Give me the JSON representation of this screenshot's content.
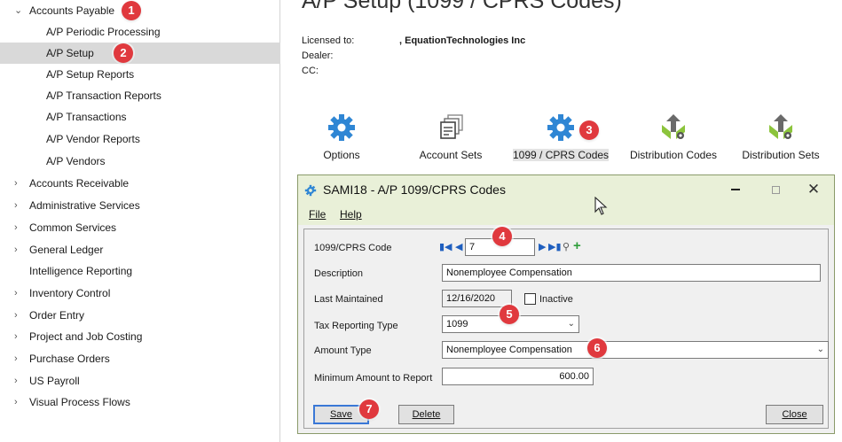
{
  "nav": {
    "items": [
      {
        "label": "Accounts Payable",
        "expanded": true,
        "badge": "1"
      },
      {
        "label": "A/P Periodic Processing"
      },
      {
        "label": "A/P Setup",
        "selected": true,
        "badge": "2"
      },
      {
        "label": "A/P Setup Reports"
      },
      {
        "label": "A/P Transaction Reports"
      },
      {
        "label": "A/P Transactions"
      },
      {
        "label": "A/P Vendor Reports"
      },
      {
        "label": "A/P Vendors"
      },
      {
        "label": "Accounts Receivable"
      },
      {
        "label": "Administrative Services"
      },
      {
        "label": "Common Services"
      },
      {
        "label": "General Ledger"
      },
      {
        "label": "Intelligence Reporting"
      },
      {
        "label": "Inventory Control"
      },
      {
        "label": "Order Entry"
      },
      {
        "label": "Project and Job Costing"
      },
      {
        "label": "Purchase Orders"
      },
      {
        "label": "US Payroll"
      },
      {
        "label": "Visual Process Flows"
      }
    ]
  },
  "main": {
    "title": "A/P Setup (1099 / CPRS Codes)",
    "licensed_label": "Licensed to:",
    "licensed_value": ", EquationTechnologies Inc",
    "dealer_label": "Dealer:",
    "cc_label": "CC:",
    "tiles": [
      {
        "label": "Options",
        "icon": "gear-icon"
      },
      {
        "label": "Account Sets",
        "icon": "account-sets-icon"
      },
      {
        "label": "1099 / CPRS Codes",
        "icon": "gear-icon",
        "badge": "3"
      },
      {
        "label": "Distribution Codes",
        "icon": "distribution-icon"
      },
      {
        "label": "Distribution Sets",
        "icon": "distribution-icon"
      }
    ]
  },
  "dialog": {
    "title": "SAMI18 - A/P 1099/CPRS Codes",
    "menu": {
      "file": "File",
      "help": "Help"
    },
    "fields": {
      "code_label": "1099/CPRS Code",
      "code_value": "7",
      "description_label": "Description",
      "description_value": "Nonemployee Compensation",
      "last_maintained_label": "Last Maintained",
      "last_maintained_value": "12/16/2020",
      "inactive_label": "Inactive",
      "tax_type_label": "Tax Reporting Type",
      "tax_type_value": "1099",
      "amount_type_label": "Amount Type",
      "amount_type_value": "Nonemployee Compensation",
      "min_amount_label": "Minimum Amount to Report",
      "min_amount_value": "600.00"
    },
    "buttons": {
      "save": "Save",
      "delete": "Delete",
      "close": "Close"
    },
    "badges": {
      "code": "4",
      "tax": "5",
      "amount": "6",
      "save": "7"
    }
  },
  "colors": {
    "badge": "#e0393e",
    "gear_blue": "#2f86d4",
    "dialog_title_bg": "#e9f0d8",
    "selected_row": "#d9d9d9",
    "nav_arrow_blue": "#1f5fbf",
    "plus_green": "#2e9d3a"
  }
}
